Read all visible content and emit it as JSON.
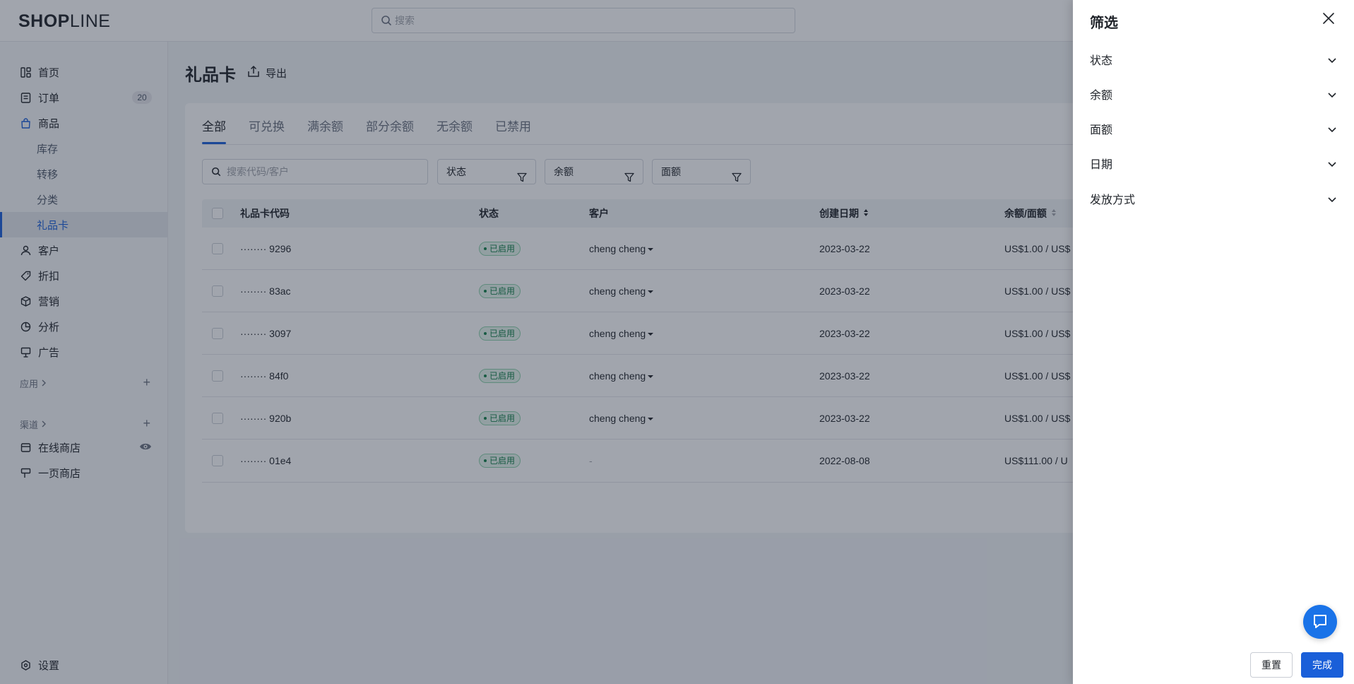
{
  "app": {
    "logo_bold": "SHOP",
    "logo_light": "LINE"
  },
  "topbar": {
    "search_placeholder": "搜索"
  },
  "sidebar": {
    "items": [
      {
        "label": "首页"
      },
      {
        "label": "订单",
        "badge": "20"
      },
      {
        "label": "商品"
      }
    ],
    "sub_items": [
      {
        "label": "库存"
      },
      {
        "label": "转移"
      },
      {
        "label": "分类"
      },
      {
        "label": "礼品卡"
      }
    ],
    "items2": [
      {
        "label": "客户"
      },
      {
        "label": "折扣"
      },
      {
        "label": "营销"
      },
      {
        "label": "分析"
      },
      {
        "label": "广告"
      }
    ],
    "apps_label": "应用",
    "channels_label": "渠道",
    "channels": [
      {
        "label": "在线商店"
      },
      {
        "label": "一页商店"
      }
    ],
    "settings_label": "设置"
  },
  "page": {
    "title": "礼品卡",
    "export_label": "导出",
    "tabs": [
      "全部",
      "可兑换",
      "满余额",
      "部分余额",
      "无余额",
      "已禁用"
    ],
    "search_placeholder": "搜索代码/客户",
    "filters": [
      "状态",
      "余额",
      "面额"
    ],
    "columns": [
      "礼品卡代码",
      "状态",
      "客户",
      "创建日期",
      "余额/面额"
    ],
    "rows": [
      {
        "code": "········ 9296",
        "status": "已启用",
        "customer": "cheng cheng",
        "date": "2023-03-22",
        "balance": "US$1.00 / US$"
      },
      {
        "code": "········ 83ac",
        "status": "已启用",
        "customer": "cheng cheng",
        "date": "2023-03-22",
        "balance": "US$1.00 / US$"
      },
      {
        "code": "········ 3097",
        "status": "已启用",
        "customer": "cheng cheng",
        "date": "2023-03-22",
        "balance": "US$1.00 / US$"
      },
      {
        "code": "········ 84f0",
        "status": "已启用",
        "customer": "cheng cheng",
        "date": "2023-03-22",
        "balance": "US$1.00 / US$"
      },
      {
        "code": "········ 920b",
        "status": "已启用",
        "customer": "cheng cheng",
        "date": "2023-03-22",
        "balance": "US$1.00 / US$"
      },
      {
        "code": "········ 01e4",
        "status": "已启用",
        "customer": "-",
        "date": "2022-08-08",
        "balance": "US$111.00 / U"
      }
    ]
  },
  "drawer": {
    "title": "筛选",
    "sections": [
      "状态",
      "余额",
      "面额",
      "日期",
      "发放方式"
    ],
    "reset_label": "重置",
    "done_label": "完成"
  },
  "colors": {
    "accent": "#1a5fd9",
    "success": "#14804a",
    "chat": "#1a73e8"
  }
}
